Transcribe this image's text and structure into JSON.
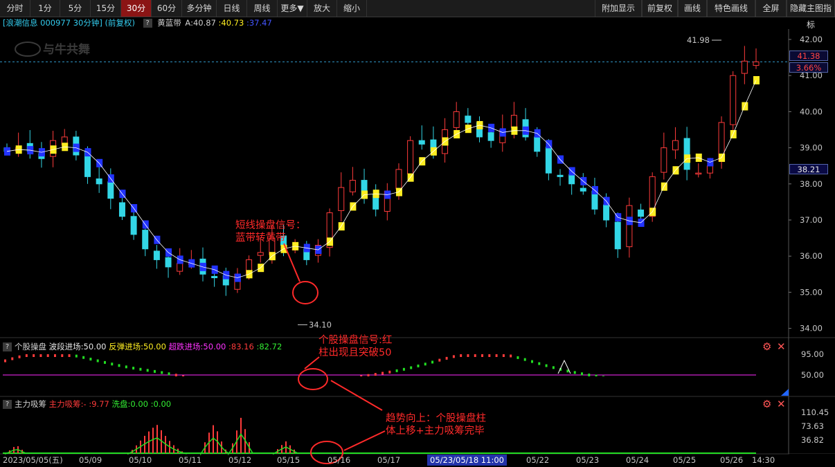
{
  "toolbar": {
    "left": [
      "分时",
      "1分",
      "5分",
      "15分",
      "30分",
      "60分",
      "多分钟",
      "日线",
      "周线",
      "更多▼",
      "放大",
      "缩小"
    ],
    "active": "30分",
    "right": [
      "附加显示",
      "前复权",
      "画线",
      "特色画线",
      "全屏",
      "隐藏主图指标"
    ]
  },
  "info": {
    "stock": "[浪潮信息 000977 30分钟] (前复权)",
    "indicator": "黄蓝带",
    "a_label": "A:40.87",
    "v1": ":40.73",
    "v2": ":37.47"
  },
  "watermark": "与牛共舞",
  "price_axis": [
    "42.00",
    "41.00",
    "40.00",
    "39.00",
    "38.00",
    "37.00",
    "36.00",
    "35.00",
    "34.00"
  ],
  "price_tags": {
    "current": "41.38",
    "pct": "3.66%",
    "cursor": "38.21"
  },
  "main_marks": {
    "high": "41.98",
    "low": "34.10"
  },
  "panel1": {
    "title": "个股操盘",
    "l1": "波段进场:50.00",
    "l2": "反弹进场:50.00",
    "l3": "超跌进场:50.00",
    "l4": ":83.16",
    "l5": ":82.72",
    "axis": [
      "95.00",
      "50.00"
    ]
  },
  "panel2": {
    "title": "主力吸筹",
    "l1": "主力吸筹:-",
    "l2": ":9.77",
    "l3": "洗盘:0.00",
    "l4": ":0.00",
    "axis": [
      "110.45",
      "73.63",
      "36.82"
    ]
  },
  "dates": {
    "first": "2023/05/05(五)",
    "list": [
      "05/09",
      "05/10",
      "05/11",
      "05/12",
      "05/15",
      "05/16",
      "05/17",
      "05/22",
      "05/23",
      "05/24",
      "05/25",
      "05/26"
    ],
    "cursor": "05/23/05/18 11:00",
    "last": "14:30"
  },
  "annotations": {
    "a1": [
      "短线操盘信号：",
      "蓝带转黄带"
    ],
    "a2": [
      "个股操盘信号:红",
      "柱出现且突破50"
    ],
    "a3": [
      "趋势向上：个股操盘柱",
      "体上移+主力吸筹完毕"
    ]
  },
  "colors": {
    "up": "#ff3b3b",
    "down": "#33d6e6",
    "yellow": "#ffee22",
    "blue": "#2233ff",
    "magenta": "#ff2aff",
    "green": "#22dd22",
    "accent": "#8b1515"
  },
  "chart_data": {
    "type": "candlestick",
    "title": "",
    "x_dates": [
      "05/05",
      "05/09",
      "05/10",
      "05/11",
      "05/12",
      "05/15",
      "05/16",
      "05/17",
      "05/18",
      "05/22",
      "05/23",
      "05/24",
      "05/25",
      "05/26"
    ],
    "y_range": [
      34.0,
      42.0
    ],
    "close_series": [
      38.9,
      39.0,
      38.9,
      38.7,
      39.2,
      39.3,
      38.8,
      38.2,
      38.0,
      37.6,
      37.1,
      36.6,
      36.2,
      35.9,
      35.7,
      35.8,
      35.8,
      35.5,
      35.4,
      35.2,
      35.5,
      35.9,
      36.1,
      36.5,
      36.3,
      36.2,
      35.9,
      36.3,
      37.2,
      37.9,
      38.1,
      37.6,
      37.3,
      37.8,
      38.4,
      39.2,
      39.1,
      38.9,
      39.5,
      40.0,
      39.7,
      39.3,
      39.2,
      39.5,
      39.9,
      39.3,
      38.9,
      38.3,
      38.2,
      38.0,
      37.8,
      37.3,
      37.0,
      36.2,
      37.4,
      37.1,
      38.2,
      39.0,
      39.2,
      38.4,
      38.3,
      38.5,
      39.7,
      41.0,
      41.4,
      41.38
    ],
    "price_marks": {
      "high": 41.98,
      "low": 34.1
    },
    "band_last": {
      "A": 40.87,
      "yellow": 40.73,
      "blue": 37.47
    },
    "panel1_levels": [
      50,
      95
    ],
    "panel2_levels": [
      36.82,
      73.63,
      110.45
    ]
  }
}
